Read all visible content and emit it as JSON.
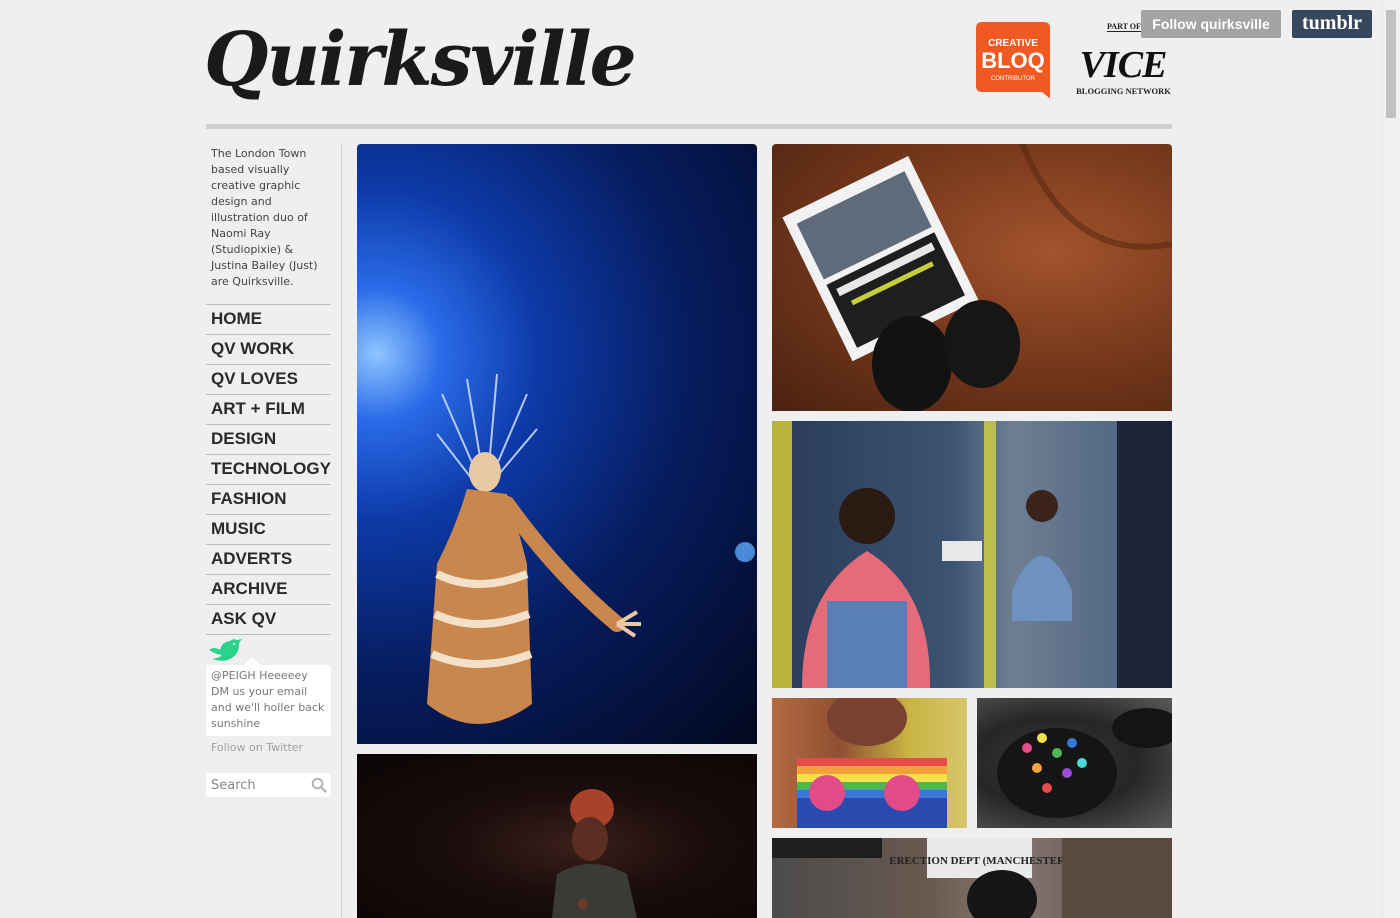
{
  "toolbar": {
    "follow_label": "Follow quirksville",
    "tumblr_label": "tumblr"
  },
  "header": {
    "logo_text": "Quirksville",
    "badge": {
      "line1": "CREATIVE",
      "line2": "BLOQ",
      "line3": "CONTRIBUTOR",
      "color": "#f05a22"
    },
    "part_of": "PART OF",
    "vice_logo": "VICE",
    "vice_sub": "BLOGGING NETWORK"
  },
  "sidebar": {
    "bio": "The London Town based visually creative graphic design and illustration duo of Naomi Ray (Studiopixie) & Justina Bailey (Just) are Quirksville.",
    "nav": [
      {
        "label": "HOME"
      },
      {
        "label": "QV WORK"
      },
      {
        "label": "QV LOVES"
      },
      {
        "label": "ART + FILM"
      },
      {
        "label": "DESIGN"
      },
      {
        "label": "TECHNOLOGY"
      },
      {
        "label": "FASHION"
      },
      {
        "label": "MUSIC"
      },
      {
        "label": "ADVERTS"
      },
      {
        "label": "ARCHIVE"
      },
      {
        "label": "ASK QV"
      }
    ],
    "tweet": "@PEIGH Heeeeey DM us your email and we'll holler back sunshine",
    "follow_twitter": "Follow on Twitter",
    "search_placeholder": "Search",
    "twitter_color": "#2ad38a"
  },
  "posts": [
    {
      "name": "performer-photo"
    },
    {
      "name": "singer-photo"
    },
    {
      "name": "flyer-boots-photo"
    },
    {
      "name": "shop-mirror-photo"
    },
    {
      "name": "rainbow-jumper-photo"
    },
    {
      "name": "decorated-boot-photo"
    },
    {
      "name": "election-dept-photo",
      "sign_text": "ERECTION DEPT (MANCHESTER)"
    }
  ]
}
